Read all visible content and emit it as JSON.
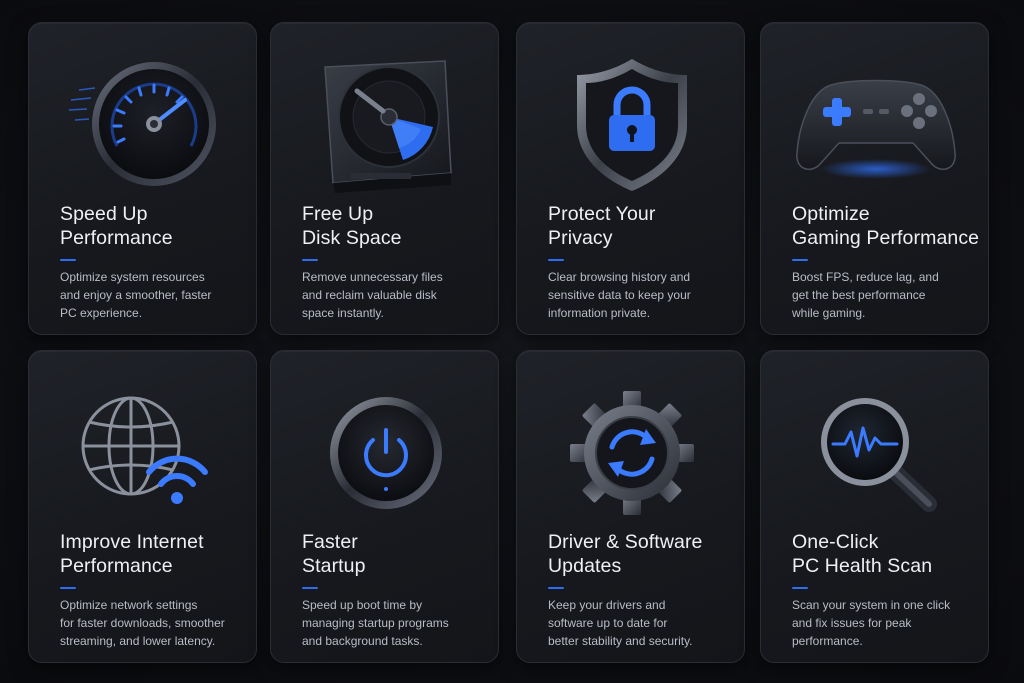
{
  "accent_color": "#2f6df0",
  "cards": [
    {
      "icon": "speedometer-icon",
      "title": [
        "Speed Up",
        "Performance"
      ],
      "description": [
        "Optimize system resources",
        "and enjoy a smoother, faster",
        "PC experience."
      ]
    },
    {
      "icon": "hard-disk-icon",
      "title": [
        "Free Up",
        "Disk Space"
      ],
      "description": [
        "Remove unnecessary files",
        "and reclaim valuable disk",
        "space instantly."
      ]
    },
    {
      "icon": "shield-lock-icon",
      "title": [
        "Protect Your",
        "Privacy"
      ],
      "description": [
        "Clear browsing history and",
        "sensitive data to keep your",
        "information private."
      ]
    },
    {
      "icon": "gamepad-icon",
      "title": [
        "Optimize",
        "Gaming Performance"
      ],
      "description": [
        "Boost FPS, reduce lag, and",
        "get the best performance",
        "while gaming."
      ]
    },
    {
      "icon": "globe-wifi-icon",
      "title": [
        "Improve Internet",
        "Performance"
      ],
      "description": [
        "Optimize network settings",
        "for faster downloads, smoother",
        "streaming, and lower latency."
      ]
    },
    {
      "icon": "power-button-icon",
      "title": [
        "Faster",
        "Startup"
      ],
      "description": [
        "Speed up boot time by",
        "managing startup programs",
        "and background tasks."
      ]
    },
    {
      "icon": "gear-refresh-icon",
      "title": [
        "Driver & Software",
        "Updates"
      ],
      "description": [
        "Keep your drivers and",
        "software up to date for",
        "better stability and security."
      ]
    },
    {
      "icon": "magnifier-pulse-icon",
      "title": [
        "One-Click",
        "PC Health Scan"
      ],
      "description": [
        "Scan your system in one click",
        "and fix issues for peak",
        "performance."
      ]
    }
  ]
}
